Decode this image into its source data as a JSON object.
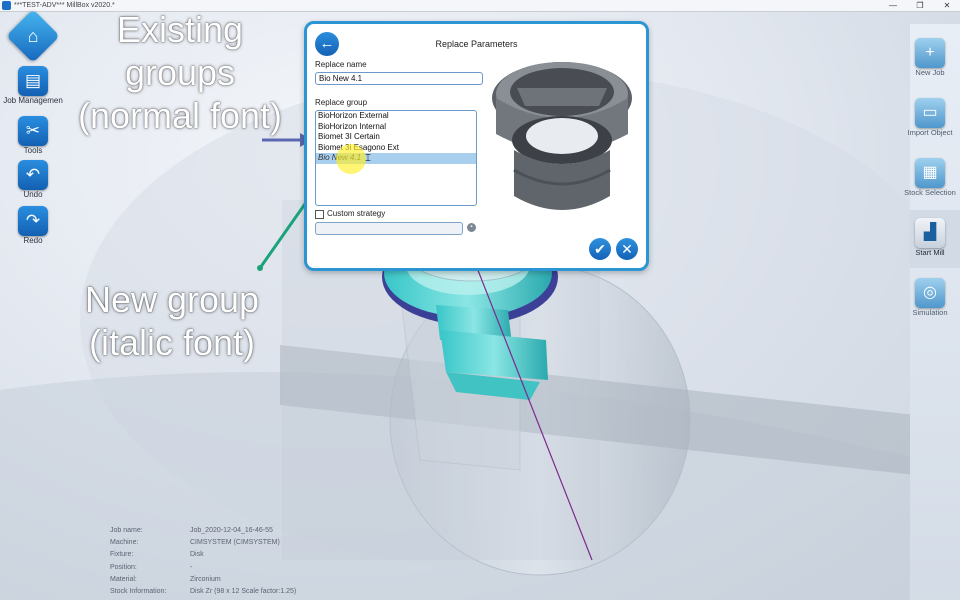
{
  "window": {
    "title": "***TEST-ADV*** MillBox v2020.*",
    "min_glyph": "—",
    "restore_glyph": "❐",
    "close_glyph": "✕"
  },
  "left_toolbar": {
    "home_icon": "⌂",
    "items": [
      {
        "label": "Job Managemen",
        "icon": "job-icon",
        "glyph": "▤"
      },
      {
        "label": "Tools",
        "icon": "tools-icon",
        "glyph": "✂"
      },
      {
        "label": "Undo",
        "icon": "undo-icon",
        "glyph": "↶"
      },
      {
        "label": "Redo",
        "icon": "redo-icon",
        "glyph": "↷"
      }
    ]
  },
  "right_toolbar": {
    "items": [
      {
        "label": "New Job",
        "icon": "new-job-icon",
        "glyph": "+"
      },
      {
        "label": "Import Object",
        "icon": "import-object-icon",
        "glyph": "▭"
      },
      {
        "label": "Stock Selection",
        "icon": "stock-selection-icon",
        "glyph": "▦"
      },
      {
        "label": "Start Mill",
        "icon": "start-mill-icon",
        "glyph": "▟"
      },
      {
        "label": "Simulation",
        "icon": "simulation-icon",
        "glyph": "◎"
      }
    ]
  },
  "annotations": {
    "existing_line1": "Existing",
    "existing_line2": "groups",
    "existing_line3": "(normal font)",
    "new_line1": "New group",
    "new_line2": "(italic font)",
    "color_arrow_existing": "#5b68b0",
    "color_arrow_new": "#1aa37a"
  },
  "dialog": {
    "back_glyph": "←",
    "title": "Replace Parameters",
    "replace_name_label": "Replace name",
    "replace_name_value": "Bio New 4.1",
    "replace_group_label": "Replace group",
    "groups": [
      "BioHorizon External",
      "BioHorizon Internal",
      "Biomet 3I Certain",
      "Biomet 3i Esagono Ext",
      "Bio New 4.1"
    ],
    "selected_group_index": 4,
    "custom_strategy_label": "Custom strategy",
    "custom_strategy_checked": false,
    "custom_strategy_value": "",
    "ok_glyph": "✔",
    "cancel_glyph": "✕",
    "accent_color": "#2c95d3"
  },
  "job_info": {
    "rows": [
      {
        "key": "Job name:",
        "value": "Job_2020-12-04_16-46-55"
      },
      {
        "key": "Machine:",
        "value": "CIMSYSTEM (CIMSYSTEM)"
      },
      {
        "key": "Fixture:",
        "value": "Disk"
      },
      {
        "key": "Position:",
        "value": "-"
      },
      {
        "key": "Material:",
        "value": "Zirconium"
      },
      {
        "key": "Stock Information:",
        "value": "Disk Zr (98 x 12 Scale factor:1.25)"
      }
    ]
  }
}
